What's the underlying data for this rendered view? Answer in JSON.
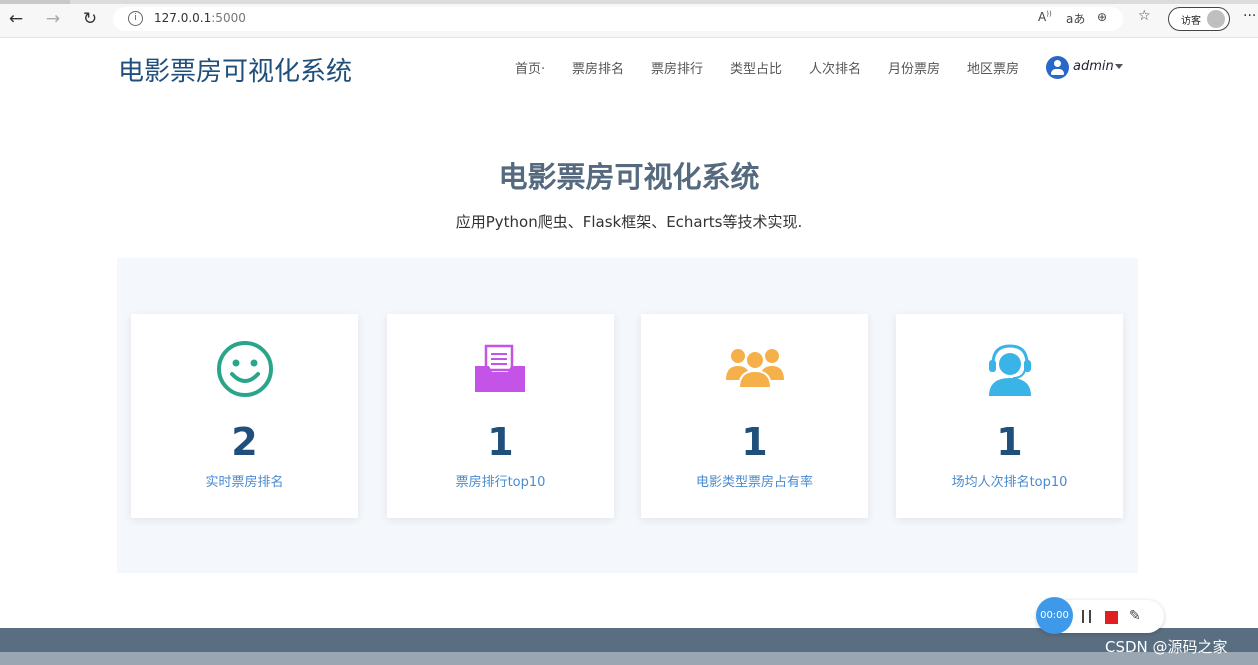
{
  "browser": {
    "url_host": "127.0.0.1",
    "url_port": ":5000",
    "guest_label": "访客",
    "icons": [
      "back-icon",
      "forward-icon",
      "reload-icon",
      "info-icon",
      "read-aloud-icon",
      "translate-icon",
      "zoom-icon",
      "favorites-icon",
      "more-icon"
    ]
  },
  "header": {
    "brand": "电影票房可视化系统",
    "nav": [
      "首页·",
      "票房排名",
      "票房排行",
      "类型占比",
      "人次排名",
      "月份票房",
      "地区票房"
    ],
    "user": "admin"
  },
  "hero": {
    "title": "电影票房可视化系统",
    "subtitle": "应用Python爬虫、Flask框架、Echarts等技术实现."
  },
  "stats": [
    {
      "icon": "smile-icon",
      "value": "2",
      "label": "实时票房排名",
      "color": "#2aa58a"
    },
    {
      "icon": "inbox-tray-icon",
      "value": "1",
      "label": "票房排行top10",
      "color": "#c454e8"
    },
    {
      "icon": "people-group-icon",
      "value": "1",
      "label": "电影类型票房占有率",
      "color": "#f5b04a"
    },
    {
      "icon": "support-agent-icon",
      "value": "1",
      "label": "场均人次排名top10",
      "color": "#3ab3e6"
    }
  ],
  "recorder": {
    "timer": "00:00"
  },
  "watermark": "CSDN @源码之家"
}
